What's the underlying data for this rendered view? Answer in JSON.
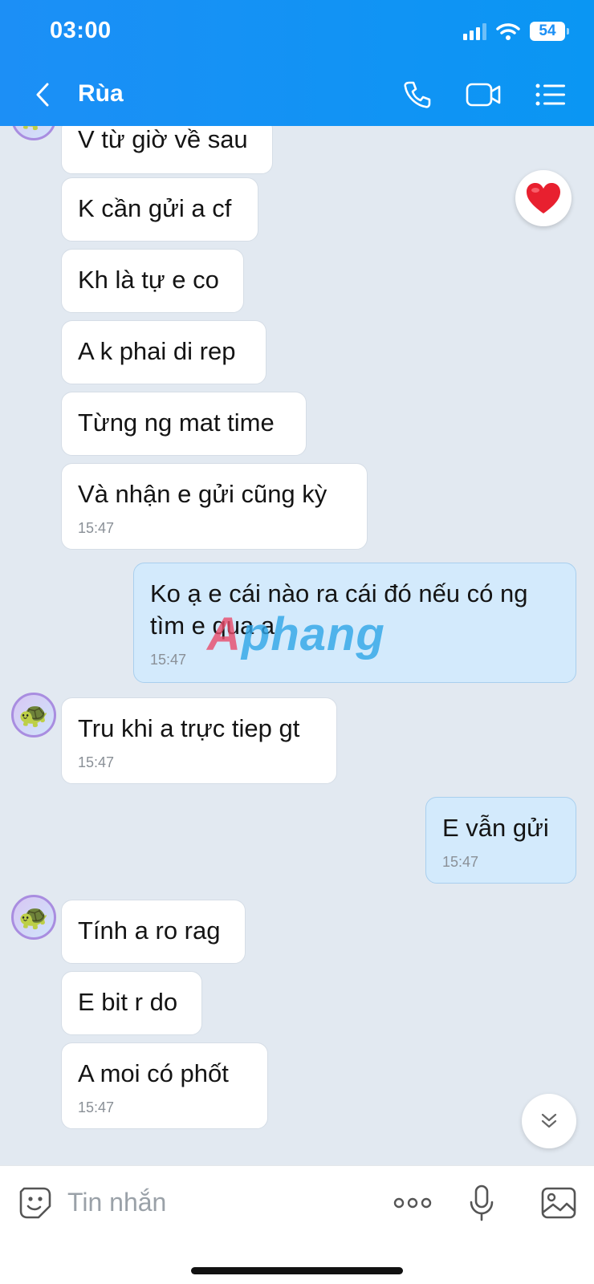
{
  "status": {
    "time": "03:00",
    "battery": "54"
  },
  "header": {
    "title": "Rùa"
  },
  "messages": [
    {
      "text": "V từ giờ về sau"
    },
    {
      "text": "K cần gửi a cf"
    },
    {
      "text": "Kh là tự e co"
    },
    {
      "text": "A k phai di rep"
    },
    {
      "text": "Từng ng mat time"
    },
    {
      "text": "Và nhận e gửi cũng kỳ",
      "time": "15:47"
    },
    {
      "text": "Ko ạ e cái nào ra cái đó nếu có ng tìm e qua a",
      "time": "15:47",
      "mine": true
    },
    {
      "text": "Tru khi a trực tiep gt",
      "time": "15:47"
    },
    {
      "text": "E vẫn gửi",
      "time": "15:47",
      "mine": true
    },
    {
      "text": "Tính a ro rag"
    },
    {
      "text": "E bit r do"
    },
    {
      "text": "A moi có phốt",
      "time": "15:47"
    }
  ],
  "watermark": {
    "part1": "A",
    "part2": "phang"
  },
  "input": {
    "placeholder": "Tin nhắn"
  },
  "icons": {
    "back": "chevron-left-icon",
    "call": "phone-icon",
    "video": "video-camera-icon",
    "menu": "list-menu-icon",
    "reaction": "heart-icon",
    "scroll": "double-chevron-down-icon",
    "sticker": "smiley-sticker-icon",
    "more": "more-dots-icon",
    "mic": "microphone-icon",
    "gallery": "image-gallery-icon",
    "avatar": "turtle-icon"
  },
  "colors": {
    "header": "#1a8ff5",
    "mine_bubble": "#d3eafc",
    "background": "#e2e9f1"
  }
}
